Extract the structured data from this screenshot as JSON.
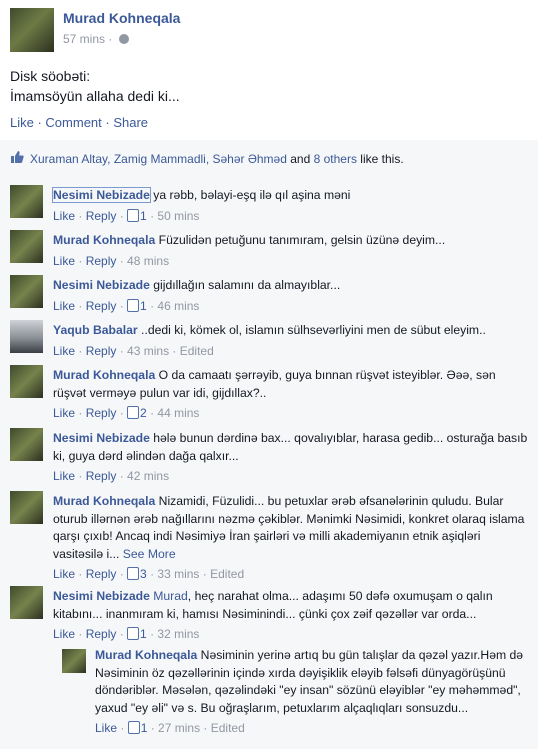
{
  "post": {
    "author": "Murad Kohneqala",
    "time": "57 mins",
    "line1": "Disk söobəti:",
    "line2": "İmamsöyün allaha dedi ki...",
    "actions": {
      "like": "Like",
      "comment": "Comment",
      "share": "Share",
      "sep": " · "
    }
  },
  "likes": {
    "names": "Xuraman Altay, Zamig Mammadli, Səhər Əhməd",
    "and": " and ",
    "others": "8 others",
    "suffix": " like this."
  },
  "comments": [
    {
      "name": "Nesimi Nebizade",
      "text": " ya rəbb, bəlayi-eşq ilə qıl aşina məni",
      "like": "Like",
      "reply": "Reply",
      "likes": "1",
      "time": "50 mins",
      "edited": ""
    },
    {
      "name": "Murad Kohneqala",
      "text": " Füzulidən petuğunu tanımıram, gelsin üzünə deyim...",
      "like": "Like",
      "reply": "Reply",
      "likes": "",
      "time": "48 mins",
      "edited": ""
    },
    {
      "name": "Nesimi Nebizade",
      "text": " gijdıllağın salamını da almayıblar...",
      "like": "Like",
      "reply": "Reply",
      "likes": "1",
      "time": "46 mins",
      "edited": ""
    },
    {
      "name": "Yaqub Babalar",
      "text": " ..dedi ki, kömek ol, islamın sülhsevərliyini men de sübut eleyim..",
      "like": "Like",
      "reply": "Reply",
      "likes": "",
      "time": "43 mins",
      "edited": "Edited"
    },
    {
      "name": "Murad Kohneqala",
      "text": " O da camaatı şərrəyib, guya bınnan rüşvət isteyiblər. Əəə, sən rüşvət verməyə pulun var idi, gijdıllax?..",
      "like": "Like",
      "reply": "Reply",
      "likes": "2",
      "time": "44 mins",
      "edited": ""
    },
    {
      "name": "Nesimi Nebizade",
      "text": " hələ bunun dərdinə bax... qovalıyıblar, harasa gedib... osturağa basıb ki, guya dərd əlindən dağa qalxır...",
      "like": "Like",
      "reply": "Reply",
      "likes": "",
      "time": "42 mins",
      "edited": ""
    },
    {
      "name": "Murad Kohneqala",
      "text": " Nizamidi, Füzulidi... bu petuxlar ərəb əfsanələrinin quludu. Bular oturub illərnən ərəb nağıllarını nəzmə çəkiblər. Mənimki Nəsimidi, konkret olaraq islama qarşı çıxıb! Ancaq indi Nəsimiyə İran şairləri və milli akademiyanın etnik aşiqləri vasitəsilə i... ",
      "more": "See More",
      "like": "Like",
      "reply": "Reply",
      "likes": "3",
      "time": "33 mins",
      "edited": "Edited"
    },
    {
      "name": "Nesimi Nebizade",
      "mention": "Murad",
      "text": ", heç narahat olma... adaşımı 50 dəfə oxumuşam o qalın kitabını... inanmıram ki, hamısı Nəsiminindi... çünki çox zəif qəzəllər var orda...",
      "like": "Like",
      "reply": "Reply",
      "likes": "1",
      "time": "32 mins",
      "edited": ""
    }
  ],
  "reply": {
    "name": "Murad Kohneqala",
    "text": " Nəsiminin yerinə artıq bu gün talışlar da qəzəl yazır.Həm də Nəsiminin öz qəzəllərinin içində xırda dəyişiklik eləyib fəlsəfi dünyagörüşünü döndəriblər. Məsələn, qəzəlindəki \"ey insan\" sözünü eləyiblər \"ey məhəmməd\", yaxud \"ey əli\" və s. Bu oğraşlarım, petuxlarım alçaqlıqları sonsuzdu...",
    "like": "Like",
    "likes": "1",
    "time": "27 mins",
    "edited": "Edited"
  },
  "dot": " · ",
  "colors": {
    "link": "#3b5998",
    "meta": "#9197a3",
    "comment_bg": "#f6f7f8"
  },
  "icons": [
    "globe-icon",
    "thumbs-up-icon"
  ]
}
